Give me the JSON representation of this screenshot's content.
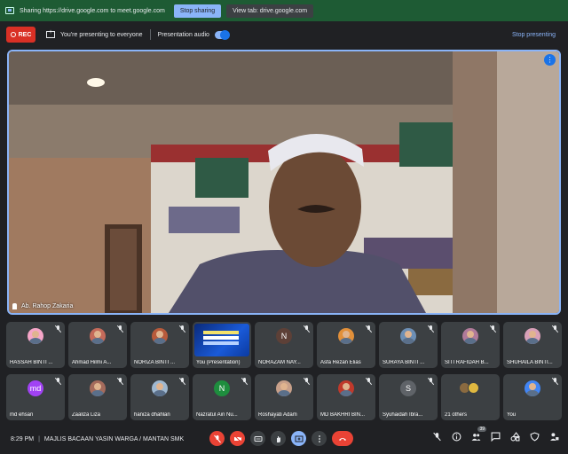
{
  "share_bar": {
    "text": "Sharing https://drive.google.com to meet.google.com",
    "stop_sharing": "Stop sharing",
    "view_tab": "View tab: drive.google.com"
  },
  "present_bar": {
    "rec_label": "REC",
    "presenting_text": "You're presenting to everyone",
    "audio_label": "Presentation audio",
    "stop_presenting": "Stop presenting"
  },
  "main": {
    "speaker_name": "Ab. Rahop Zakaria"
  },
  "participants": [
    {
      "name": "HASSAH BINTI ...",
      "avatar_color": "#f6a6c8"
    },
    {
      "name": "Ahmad Hilmi A...",
      "avatar_color": "#c46a5a"
    },
    {
      "name": "NORIZA BINTI ...",
      "avatar_color": "#b85a3b"
    },
    {
      "name": "You (Presentation)",
      "avatar_color": "#1a5ad8"
    },
    {
      "name": "NORAZAM NAY...",
      "initial": "N",
      "avatar_color": "#5d4037"
    },
    {
      "name": "Asfa Rezan Elias",
      "avatar_color": "#e2903a"
    },
    {
      "name": "SURAYA BINTI ...",
      "avatar_color": "#6d8fb5"
    },
    {
      "name": "SITI RAFIDAH B...",
      "avatar_color": "#b07a9a"
    },
    {
      "name": "SHUHAILA BINTI...",
      "avatar_color": "#d8a0b8"
    },
    {
      "name": "md ehsan",
      "initial": "md",
      "avatar_color": "#a142f4"
    },
    {
      "name": "Zaaliza Liza",
      "avatar_color": "#a56b5c"
    },
    {
      "name": "haniza dhahlan",
      "avatar_color": "#9fb8d0"
    },
    {
      "name": "Nazratul Ain Nu...",
      "initial": "N",
      "avatar_color": "#1e8e3e"
    },
    {
      "name": "Roshayati Adam",
      "avatar_color": "#c8a08a"
    },
    {
      "name": "MD BAKHRI BIN...",
      "avatar_color": "#c0392b"
    },
    {
      "name": "Syuhaidah Ibra...",
      "initial": "S",
      "avatar_color": "#5f6368"
    },
    {
      "name": "21 others"
    },
    {
      "name": "You",
      "avatar_color": "#4285f4"
    }
  ],
  "bottom": {
    "time": "8:29 PM",
    "separator": "|",
    "meeting_title": "MAJLIS BACAAN YASIN WARGA / MANTAN SMK",
    "participant_count": "39"
  }
}
